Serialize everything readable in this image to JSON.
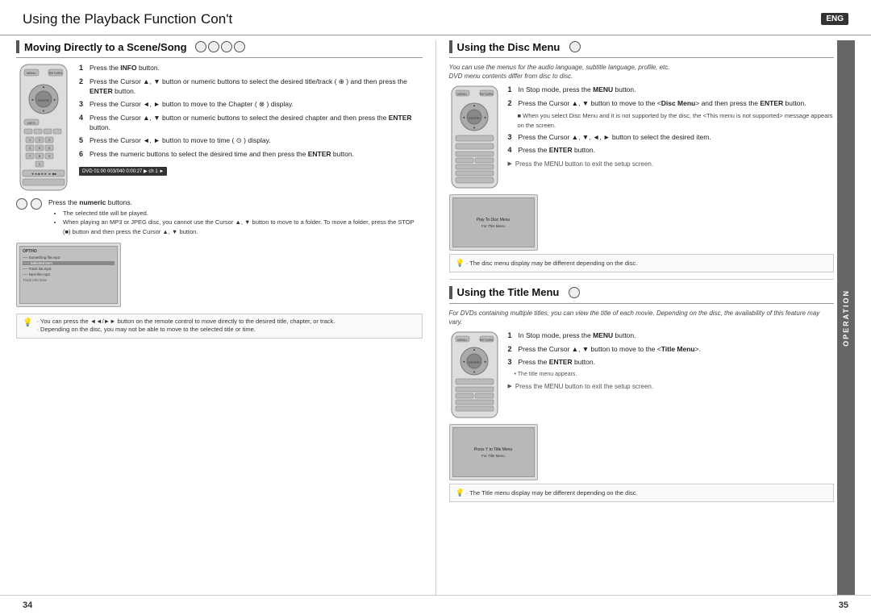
{
  "header": {
    "title": "Using the Playback Function",
    "subtitle": "Con't",
    "eng_label": "ENG"
  },
  "left": {
    "section_title": "Moving Directly to a Scene/Song",
    "remote_steps": [
      {
        "num": "1",
        "text": "Press the ",
        "bold": "INFO",
        "text2": " button."
      },
      {
        "num": "2",
        "text": "Press the Cursor ▲, ▼ button or numeric buttons to select the desired title/track (",
        "bold": "",
        "text2": ") and then press the ENTER button."
      },
      {
        "num": "3",
        "text": "Press the Cursor ◄, ► button to move to the Chapter (",
        "bold": "",
        "text2": ") display."
      },
      {
        "num": "4",
        "text": "Press the Cursor ▲, ▼ button or numeric buttons to select the desired chapter and then press the ",
        "bold": "ENTER",
        "text2": " button."
      },
      {
        "num": "5",
        "text": "Press the Cursor ◄, ► button to move to time (",
        "bold": "",
        "text2": ") display."
      },
      {
        "num": "6",
        "text": "Press the numeric buttons to select the desired time and then press the ",
        "bold": "ENTER",
        "text2": " button."
      }
    ],
    "numeric_label": "Press the",
    "numeric_bold": "numeric",
    "numeric_text2": "buttons.",
    "bullets": [
      "The selected title will be played.",
      "When playing an MP3 or JPEG disc, you cannot use the Cursor ▲, ▼ button to move to a folder. To move a folder, press the STOP (■) button and then press the Cursor ▲, ▼ button."
    ],
    "tip": {
      "bullets": [
        "You can press the ◄◄/►► button on the remote control to move directly to the desired title, chapter, or track.",
        "Depending on the disc, you may not be able to move to the selected title or time."
      ]
    }
  },
  "right": {
    "disc_menu": {
      "section_title": "Using the Disc Menu",
      "italic1": "You can use the menus for the audio language, subtitle language, profile, etc.",
      "italic2": "DVD menu contents differ from disc to disc.",
      "steps": [
        {
          "num": "1",
          "text": "In Stop mode, press the ",
          "bold": "MENU",
          "text2": " button."
        },
        {
          "num": "2",
          "text": "Press the Cursor ▲, ▼ button to move to the <",
          "bold": "Disc Menu",
          "text2": "> and then press the ENTER button."
        },
        {
          "num": "3",
          "text": "Press the Cursor ▲, ▼, ◄, ► button to select the desired item."
        },
        {
          "num": "4",
          "text": "Press the ",
          "bold": "ENTER",
          "text2": " button."
        }
      ],
      "arrow_note": "Press the MENU button to exit the setup screen.",
      "warning_note": "When you select Disc Menu and it is not supported by the disc, the <This menu is not supported> message appears on the screen.",
      "tip": "· The disc menu display may be different depending on the disc."
    },
    "title_menu": {
      "section_title": "Using the Title Menu",
      "italic1": "For DVDs containing multiple titles, you can view the title of each movie. Depending on the disc, the availability of this feature may vary.",
      "steps": [
        {
          "num": "1",
          "text": "In Stop mode, press the ",
          "bold": "MENU",
          "text2": " button."
        },
        {
          "num": "2",
          "text": "Press the Cursor ▲, ▼ button to move to the <",
          "bold": "Title Menu",
          "text2": ">."
        },
        {
          "num": "3",
          "text": "Press the ",
          "bold": "ENTER",
          "text2": " button."
        }
      ],
      "bullet": "The title menu appears.",
      "arrow_note": "Press the MENU button to exit the setup screen.",
      "tip": "· The Title menu display may be different depending on the disc."
    }
  },
  "footer": {
    "left_page": "34",
    "right_page": "35",
    "operation_label": "OPERATION"
  }
}
